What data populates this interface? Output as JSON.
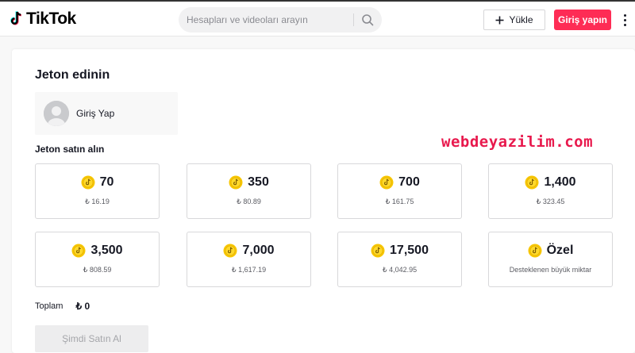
{
  "header": {
    "logo_text": "TikTok",
    "search_placeholder": "Hesapları ve videoları arayın",
    "upload_label": "Yükle",
    "login_label": "Giriş yapın"
  },
  "main": {
    "title": "Jeton edinin",
    "profile_label": "Giriş Yap",
    "section_title": "Jeton satın alın",
    "packages": [
      {
        "amount": "70",
        "price": "₺ 16.19"
      },
      {
        "amount": "350",
        "price": "₺ 80.89"
      },
      {
        "amount": "700",
        "price": "₺ 161.75"
      },
      {
        "amount": "1,400",
        "price": "₺ 323.45"
      },
      {
        "amount": "3,500",
        "price": "₺ 808.59"
      },
      {
        "amount": "7,000",
        "price": "₺ 1,617.19"
      },
      {
        "amount": "17,500",
        "price": "₺ 4,042.95"
      },
      {
        "amount": "Özel",
        "price": "Desteklenen büyük miktar"
      }
    ],
    "total_label": "Toplam",
    "total_value": "₺ 0",
    "buy_button": "Şimdi Satın Al"
  },
  "watermark": "webdeyazilim.com",
  "colors": {
    "accent": "#fe2c55",
    "coin": "#f7c600",
    "watermark": "#e8194d"
  },
  "icons": [
    "tiktok-logo-icon",
    "search-icon",
    "plus-icon",
    "more-vertical-icon",
    "avatar-icon",
    "coin-icon"
  ]
}
